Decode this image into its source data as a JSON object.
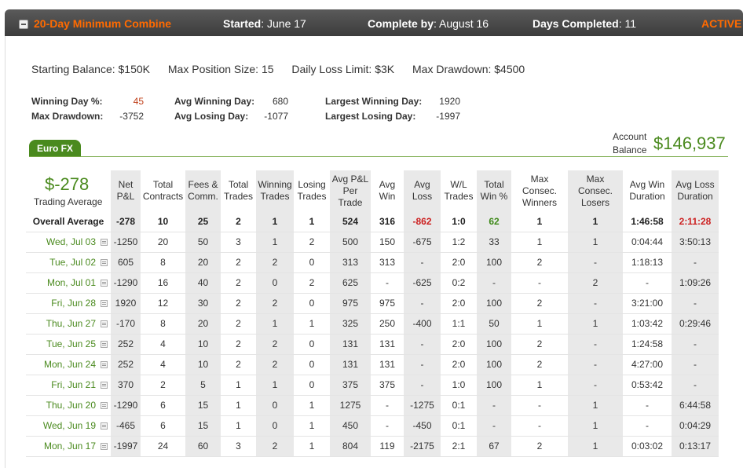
{
  "header": {
    "title": "20-Day Minimum Combine",
    "started_label": "Started",
    "started_value": ": June 17",
    "complete_label": "Complete by",
    "complete_value": ": August 16",
    "days_label": "Days Completed",
    "days_value": ": 11",
    "status": "ACTIVE"
  },
  "rules": {
    "starting_balance": "Starting Balance: $150K",
    "max_position": "Max Position Size: 15",
    "daily_loss": "Daily Loss Limit: $3K",
    "max_drawdown": "Max Drawdown: $4500"
  },
  "stats": {
    "winning_day_pct_label": "Winning Day %:",
    "winning_day_pct": "45",
    "max_drawdown_label": "Max Drawdown:",
    "max_drawdown": "-3752",
    "avg_winning_day_label": "Avg Winning Day:",
    "avg_winning_day": "680",
    "avg_losing_day_label": "Avg Losing Day:",
    "avg_losing_day": "-1077",
    "largest_winning_day_label": "Largest Winning Day:",
    "largest_winning_day": "1920",
    "largest_losing_day_label": "Largest Losing Day:",
    "largest_losing_day": "-1997"
  },
  "tab": {
    "label": "Euro FX"
  },
  "account": {
    "label_line1": "Account",
    "label_line2": "Balance",
    "value": "$146,937"
  },
  "summary": {
    "value": "$-278",
    "label": "Trading Average"
  },
  "columns": [
    "Net P&L",
    "Total Contracts",
    "Fees & Comm.",
    "Total Trades",
    "Winning Trades",
    "Losing Trades",
    "Avg P&L Per Trade",
    "Avg Win",
    "Avg Loss",
    "W/L Trades",
    "Total Win %",
    "Max Consec. Winners",
    "Max Consec. Losers",
    "Avg Win Duration",
    "Avg Loss Duration"
  ],
  "overall": {
    "label": "Overall Average",
    "cells": [
      "-278",
      "10",
      "25",
      "2",
      "1",
      "1",
      "524",
      "316",
      "-862",
      "1:0",
      "62",
      "1",
      "1",
      "1:46:58",
      "2:11:28"
    ]
  },
  "rows": [
    {
      "date": "Wed, Jul 03",
      "cells": [
        "-1250",
        "20",
        "50",
        "3",
        "1",
        "2",
        "500",
        "150",
        "-675",
        "1:2",
        "33",
        "1",
        "1",
        "0:04:44",
        "3:50:13"
      ]
    },
    {
      "date": "Tue, Jul 02",
      "cells": [
        "605",
        "8",
        "20",
        "2",
        "2",
        "0",
        "313",
        "313",
        "-",
        "2:0",
        "100",
        "2",
        "-",
        "1:18:13",
        "-"
      ]
    },
    {
      "date": "Mon, Jul 01",
      "cells": [
        "-1290",
        "16",
        "40",
        "2",
        "0",
        "2",
        "625",
        "-",
        "-625",
        "0:2",
        "-",
        "-",
        "2",
        "-",
        "1:09:26"
      ]
    },
    {
      "date": "Fri, Jun 28",
      "cells": [
        "1920",
        "12",
        "30",
        "2",
        "2",
        "0",
        "975",
        "975",
        "-",
        "2:0",
        "100",
        "2",
        "-",
        "3:21:00",
        "-"
      ]
    },
    {
      "date": "Thu, Jun 27",
      "cells": [
        "-170",
        "8",
        "20",
        "2",
        "1",
        "1",
        "325",
        "250",
        "-400",
        "1:1",
        "50",
        "1",
        "1",
        "1:03:42",
        "0:29:46"
      ]
    },
    {
      "date": "Tue, Jun 25",
      "cells": [
        "252",
        "4",
        "10",
        "2",
        "2",
        "0",
        "131",
        "131",
        "-",
        "2:0",
        "100",
        "2",
        "-",
        "1:24:58",
        "-"
      ]
    },
    {
      "date": "Mon, Jun 24",
      "cells": [
        "252",
        "4",
        "10",
        "2",
        "2",
        "0",
        "131",
        "131",
        "-",
        "2:0",
        "100",
        "2",
        "-",
        "4:27:00",
        "-"
      ]
    },
    {
      "date": "Fri, Jun 21",
      "cells": [
        "370",
        "2",
        "5",
        "1",
        "1",
        "0",
        "375",
        "375",
        "-",
        "1:0",
        "100",
        "1",
        "-",
        "0:53:42",
        "-"
      ]
    },
    {
      "date": "Thu, Jun 20",
      "cells": [
        "-1290",
        "6",
        "15",
        "1",
        "0",
        "1",
        "1275",
        "-",
        "-1275",
        "0:1",
        "-",
        "-",
        "1",
        "-",
        "6:44:58"
      ]
    },
    {
      "date": "Wed, Jun 19",
      "cells": [
        "-465",
        "6",
        "15",
        "1",
        "0",
        "1",
        "450",
        "-",
        "-450",
        "0:1",
        "-",
        "-",
        "1",
        "-",
        "0:04:29"
      ]
    },
    {
      "date": "Mon, Jun 17",
      "cells": [
        "-1997",
        "24",
        "60",
        "3",
        "2",
        "1",
        "804",
        "119",
        "-2175",
        "2:1",
        "67",
        "2",
        "1",
        "0:03:02",
        "0:13:17"
      ]
    }
  ],
  "colors": {
    "accent_orange": "#ff6a00",
    "green": "#4a8a1e",
    "red": "#cc1f1f",
    "header_bg": "#4a4a4a",
    "shade": "#e9e9e9"
  }
}
